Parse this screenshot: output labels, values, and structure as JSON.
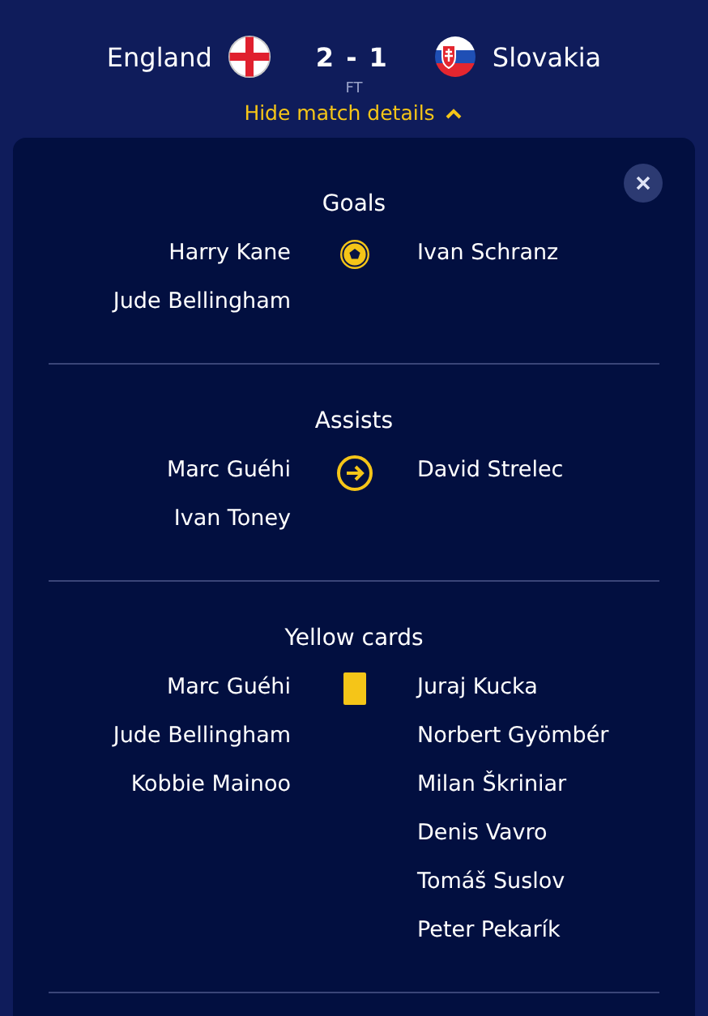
{
  "match": {
    "home": {
      "name": "England"
    },
    "away": {
      "name": "Slovakia"
    },
    "score": "2 - 1",
    "status": "FT",
    "toggle": "Hide match details",
    "expanded": true
  },
  "sections": [
    {
      "kind": "goal",
      "title": "Goals",
      "home": [
        "Harry Kane",
        "Jude Bellingham"
      ],
      "away": [
        "Ivan Schranz"
      ]
    },
    {
      "kind": "assist",
      "title": "Assists",
      "home": [
        "Marc Guéhi",
        "Ivan Toney"
      ],
      "away": [
        "David Strelec"
      ]
    },
    {
      "kind": "yellow_card",
      "title": "Yellow cards",
      "home": [
        "Marc Guéhi",
        "Jude Bellingham",
        "Kobbie Mainoo"
      ],
      "away": [
        "Juraj Kucka",
        "Norbert Gyömbér",
        "Milan Škriniar",
        "Denis Vavro",
        "Tomáš Suslov",
        "Peter Pekarík"
      ]
    }
  ]
}
